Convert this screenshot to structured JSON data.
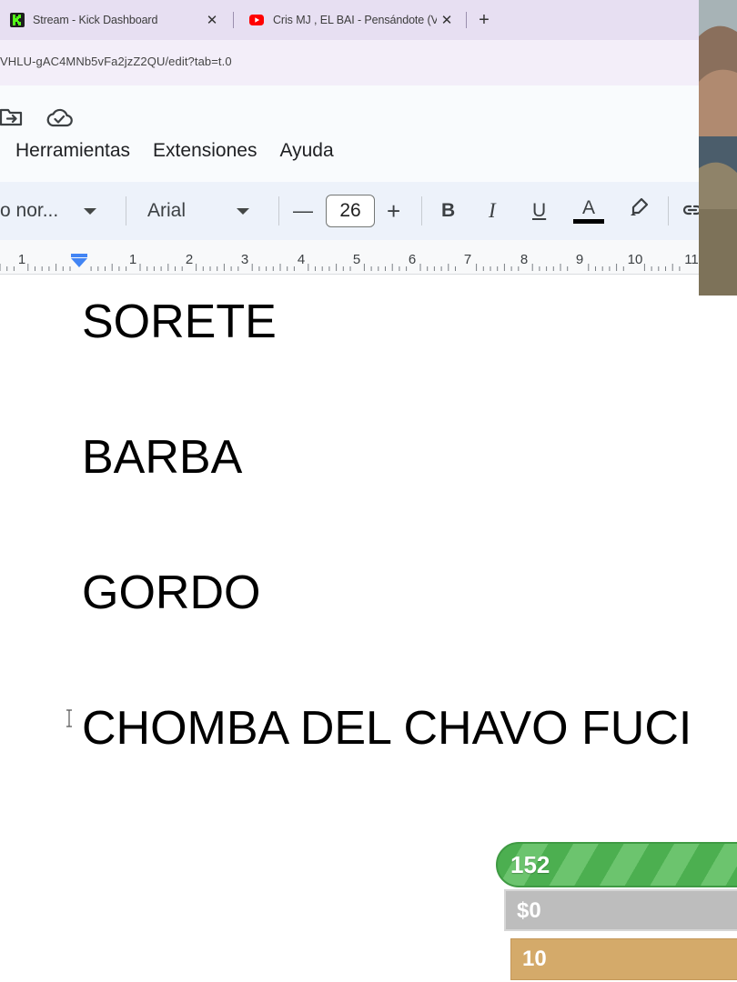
{
  "browser": {
    "tabs": [
      {
        "title": "Stream - Kick Dashboard",
        "close": "✕",
        "icon": "kick-icon"
      },
      {
        "title": "Cris MJ , EL BAI - Pensándote (V",
        "close": "✕",
        "icon": "youtube-icon"
      }
    ],
    "new_tab": "+",
    "url": "VHLU-gAC4MNb5vFa2jzZ2QU/edit?tab=t.0"
  },
  "docs": {
    "menu": [
      "Herramientas",
      "Extensiones",
      "Ayuda"
    ],
    "toolbar": {
      "style": "o nor...",
      "font": "Arial",
      "minus": "—",
      "font_size": "26",
      "plus": "+",
      "bold": "B",
      "italic": "I",
      "underline": "U",
      "text_color": "A"
    },
    "ruler": [
      "1",
      "1",
      "2",
      "3",
      "4",
      "5",
      "6",
      "7",
      "8",
      "9",
      "10",
      "11"
    ]
  },
  "document": {
    "lines": [
      "SORETE",
      "BARBA",
      "GORDO",
      "CHOMBA DEL CHAVO FUCI"
    ]
  },
  "overlay": {
    "goal_count": "152",
    "money": "$0",
    "subs_count": "10"
  },
  "colors": {
    "tab_bg": "#e7dff2",
    "toolbar_bg": "#edf2fa",
    "goal_green": "#4caf50",
    "subs_gold": "#d4aa6a"
  }
}
